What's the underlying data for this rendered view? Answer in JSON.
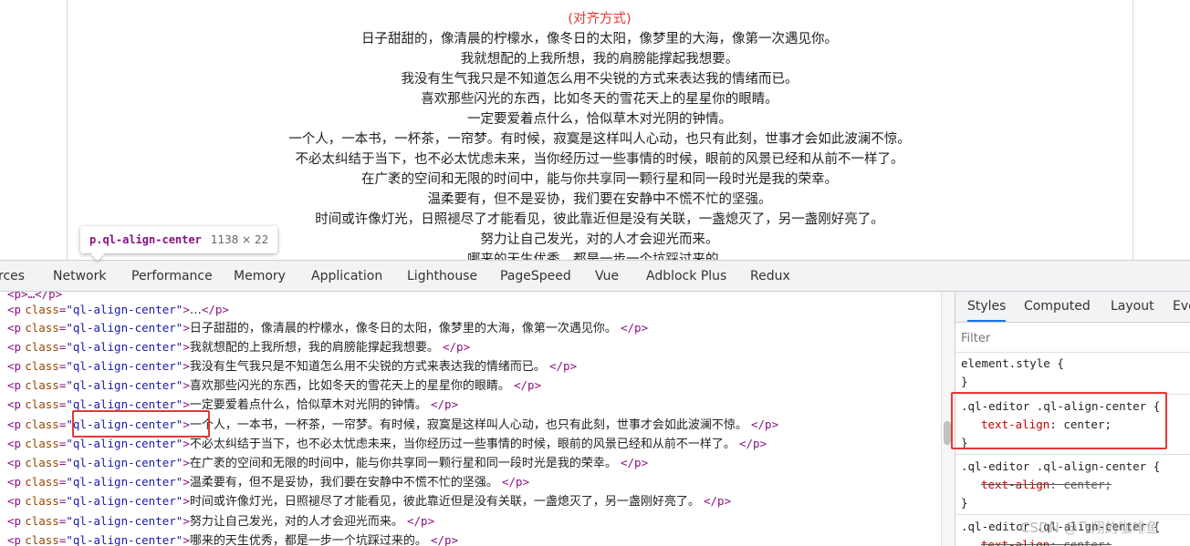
{
  "preview": {
    "title": "(对齐方式)",
    "lines": [
      "日子甜甜的，像清晨的柠檬水，像冬日的太阳，像梦里的大海，像第一次遇见你。",
      "我就想配的上我所想，我的肩膀能撑起我想要。",
      "我没有生气我只是不知道怎么用不尖锐的方式来表达我的情绪而已。",
      "喜欢那些闪光的东西，比如冬天的雪花天上的星星你的眼睛。",
      "一定要爱着点什么，恰似草木对光阴的钟情。",
      "一个人，一本书，一杯茶，一帘梦。有时候，寂寞是这样叫人心动，也只有此刻，世事才会如此波澜不惊。",
      "不必太纠结于当下，也不必太忧虑未来，当你经历过一些事情的时候，眼前的风景已经和从前不一样了。",
      "在广袤的空间和无限的时间中，能与你共享同一颗行星和同一段时光是我的荣幸。",
      "温柔要有，但不是妥协，我们要在安静中不慌不忙的坚强。",
      "时间或许像灯光，日照褪尽了才能看见，彼此靠近但是没有关联，一盏熄灭了，另一盏刚好亮了。",
      "努力让自己发光，对的人才会迎光而来。",
      "哪来的天生优秀，都是一步一个坑踩过来的。"
    ]
  },
  "tooltip": {
    "selector": "p.ql-align-center",
    "size": "1138 × 22"
  },
  "devtools_tabs": [
    "rces",
    "Network",
    "Performance",
    "Memory",
    "Application",
    "Lighthouse",
    "PageSpeed",
    "Vue",
    "Adblock Plus",
    "Redux"
  ],
  "elements": {
    "partial_top": "<p>…</p>",
    "tag_open": "<p",
    "attr_name": "class",
    "attr_value": "\"ql-align-center\"",
    "tag_gt": ">",
    "tag_close": "</p>",
    "first_row_text": "…",
    "rows": [
      "日子甜甜的，像清晨的柠檬水，像冬日的太阳，像梦里的大海，像第一次遇见你。",
      "我就想配的上我所想，我的肩膀能撑起我想要。",
      "我没有生气我只是不知道怎么用不尖锐的方式来表达我的情绪而已。",
      "喜欢那些闪光的东西，比如冬天的雪花天上的星星你的眼睛。",
      "一定要爱着点什么，恰似草木对光阴的钟情。",
      "一个人，一本书，一杯茶，一帘梦。有时候，寂寞是这样叫人心动，也只有此刻，世事才会如此波澜不惊。",
      "不必太纠结于当下，也不必太忧虑未来，当你经历过一些事情的时候，眼前的风景已经和从前不一样了。",
      "在广袤的空间和无限的时间中，能与你共享同一颗行星和同一段时光是我的荣幸。",
      "温柔要有，但不是妥协，我们要在安静中不慌不忙的坚强。",
      "时间或许像灯光，日照褪尽了才能看见，彼此靠近但是没有关联，一盏熄灭了，另一盏刚好亮了。",
      "努力让自己发光，对的人才会迎光而来。",
      "哪来的天生优秀，都是一步一个坑踩过来的。"
    ]
  },
  "styles": {
    "tabs": [
      "Styles",
      "Computed",
      "Layout",
      "Eve"
    ],
    "filter_placeholder": "Filter",
    "element_style": "element.style {",
    "close_brace": "}",
    "rule_selector": ".ql-editor .ql-align-center {",
    "prop_name": "text-align",
    "prop_sep": ": ",
    "prop_value": "center",
    "semicolon": ";",
    "third_selector": ".ql-editor .ql-align-center"
  },
  "watermark": "CSDN @飞翔的咖啡鱼",
  "colors": {
    "highlight_box": "#e53935",
    "tag": "#881280",
    "attr_name": "#994500",
    "attr_value": "#1a1aa6",
    "css_prop": "#c80000"
  }
}
